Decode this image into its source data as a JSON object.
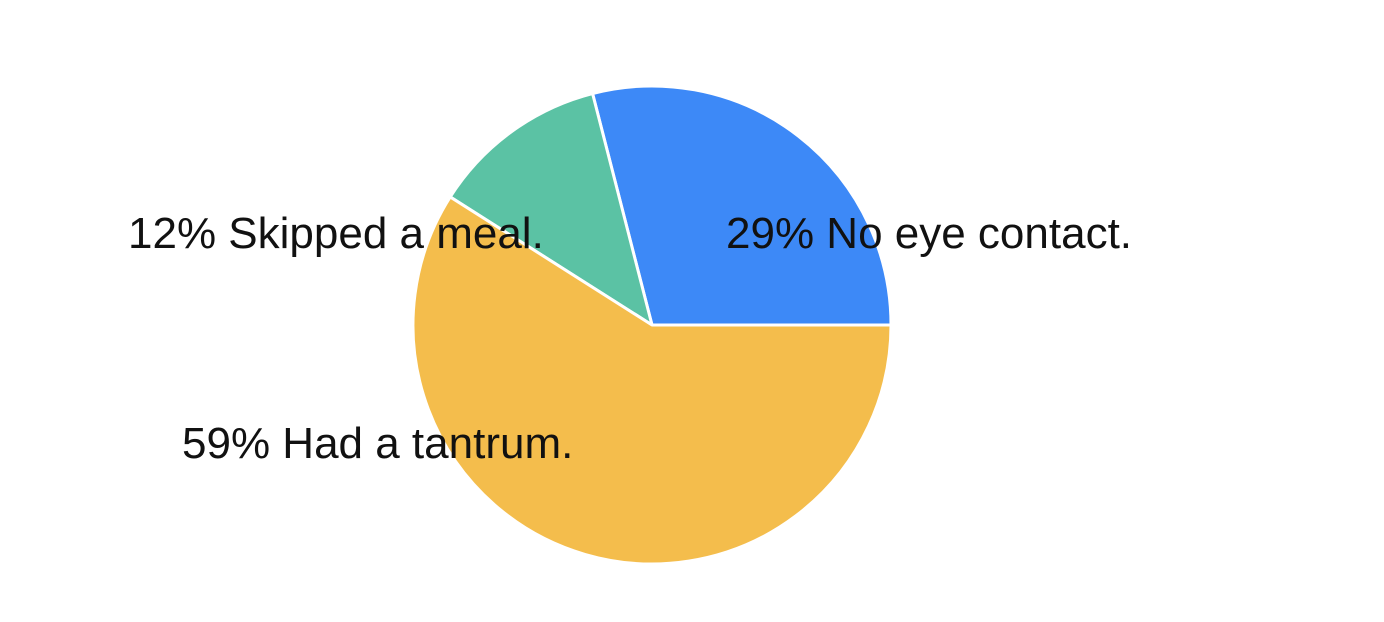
{
  "chart_data": {
    "type": "pie",
    "start_angle_deg": 0,
    "direction": "counterclockwise-from-east",
    "slices": [
      {
        "label": "No eye contact.",
        "value": 29,
        "display": "29% No eye contact.",
        "color": "#3d89f7"
      },
      {
        "label": "Skipped a meal.",
        "value": 12,
        "display": "12% Skipped a meal.",
        "color": "#5bc2a4"
      },
      {
        "label": "Had a tantrum.",
        "value": 59,
        "display": "59% Had a tantrum.",
        "color": "#f4bd4c"
      }
    ]
  }
}
